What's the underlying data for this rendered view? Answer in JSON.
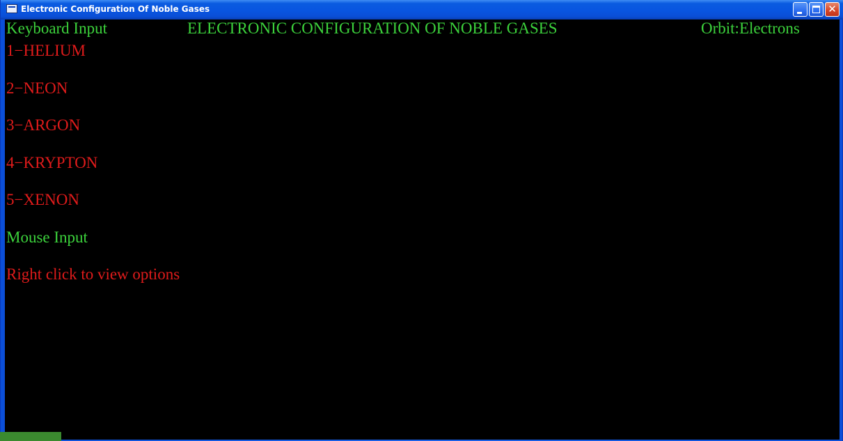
{
  "window": {
    "title": "Electronic Configuration Of Noble Gases",
    "buttons": {
      "minimize": "minimize-icon",
      "maximize": "maximize-icon",
      "close": "close-icon"
    }
  },
  "header": {
    "keyboard_label": "Keyboard Input",
    "title": "ELECTRONIC CONFIGURATION OF NOBLE GASES",
    "orbit_label": "Orbit:Electrons"
  },
  "gases": [
    {
      "label": "1−HELIUM"
    },
    {
      "label": "2−NEON"
    },
    {
      "label": "3−ARGON"
    },
    {
      "label": "4−KRYPTON"
    },
    {
      "label": "5−XENON"
    }
  ],
  "mouse": {
    "label": "Mouse Input",
    "hint": "Right click to view options"
  },
  "colors": {
    "background": "#000000",
    "heading_green": "#3cd23c",
    "item_red": "#e01b1b",
    "titlebar_blue": "#0a5be0"
  }
}
